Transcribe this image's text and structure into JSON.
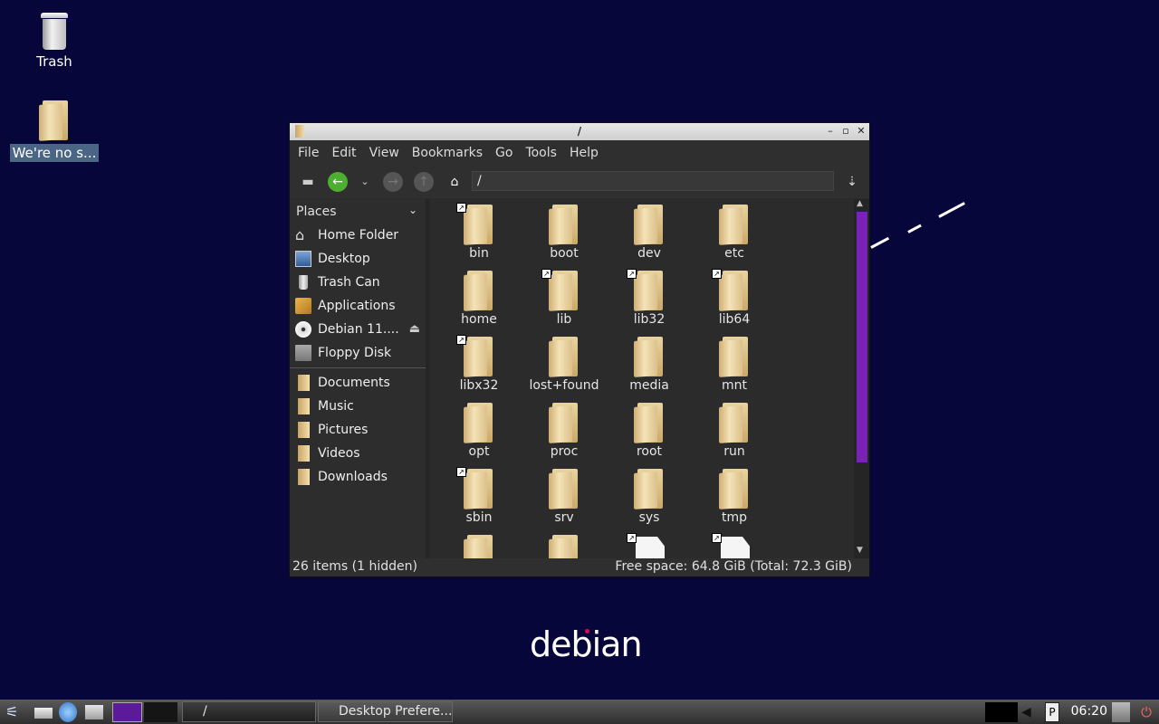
{
  "desktop": {
    "trash_label": "Trash",
    "folder_label": "We're no s..."
  },
  "window": {
    "title": "/",
    "menu": [
      "File",
      "Edit",
      "View",
      "Bookmarks",
      "Go",
      "Tools",
      "Help"
    ],
    "path": "/",
    "sidebar": {
      "heading": "Places",
      "places": [
        {
          "label": "Home Folder",
          "icon": "home-icon"
        },
        {
          "label": "Desktop",
          "icon": "desktop-icon"
        },
        {
          "label": "Trash Can",
          "icon": "trash-icon"
        },
        {
          "label": "Applications",
          "icon": "applications-icon"
        },
        {
          "label": "Debian 11....",
          "icon": "cd-drive-icon"
        },
        {
          "label": "Floppy Disk",
          "icon": "floppy-icon"
        }
      ],
      "bookmarks": [
        {
          "label": "Documents"
        },
        {
          "label": "Music"
        },
        {
          "label": "Pictures"
        },
        {
          "label": "Videos"
        },
        {
          "label": "Downloads"
        }
      ]
    },
    "files": [
      {
        "name": "bin",
        "type": "folder",
        "link": true
      },
      {
        "name": "boot",
        "type": "folder",
        "link": false
      },
      {
        "name": "dev",
        "type": "folder",
        "link": false
      },
      {
        "name": "etc",
        "type": "folder",
        "link": false
      },
      {
        "name": "home",
        "type": "folder",
        "link": false
      },
      {
        "name": "lib",
        "type": "folder",
        "link": true
      },
      {
        "name": "lib32",
        "type": "folder",
        "link": true
      },
      {
        "name": "lib64",
        "type": "folder",
        "link": true
      },
      {
        "name": "libx32",
        "type": "folder",
        "link": true
      },
      {
        "name": "lost+found",
        "type": "folder",
        "link": false
      },
      {
        "name": "media",
        "type": "folder",
        "link": false
      },
      {
        "name": "mnt",
        "type": "folder",
        "link": false
      },
      {
        "name": "opt",
        "type": "folder",
        "link": false
      },
      {
        "name": "proc",
        "type": "folder",
        "link": false
      },
      {
        "name": "root",
        "type": "folder",
        "link": false
      },
      {
        "name": "run",
        "type": "folder",
        "link": false
      },
      {
        "name": "sbin",
        "type": "folder",
        "link": true
      },
      {
        "name": "srv",
        "type": "folder",
        "link": false
      },
      {
        "name": "sys",
        "type": "folder",
        "link": false
      },
      {
        "name": "tmp",
        "type": "folder",
        "link": false
      },
      {
        "name": "",
        "type": "folder",
        "link": false
      },
      {
        "name": "",
        "type": "folder",
        "link": false
      },
      {
        "name": "",
        "type": "file",
        "link": true
      },
      {
        "name": "",
        "type": "file",
        "link": true
      }
    ],
    "status_left": "26 items (1 hidden)",
    "status_right": "Free space: 64.8 GiB (Total: 72.3 GiB)",
    "scrollbar_color": "#7a21b7"
  },
  "wallpaper": {
    "logo_text": "debian",
    "background": "#07063a"
  },
  "taskbar": {
    "tasks": [
      {
        "label": "/",
        "active": true
      },
      {
        "label": "Desktop Prefere...",
        "active": false
      }
    ],
    "clock": "06:20"
  }
}
